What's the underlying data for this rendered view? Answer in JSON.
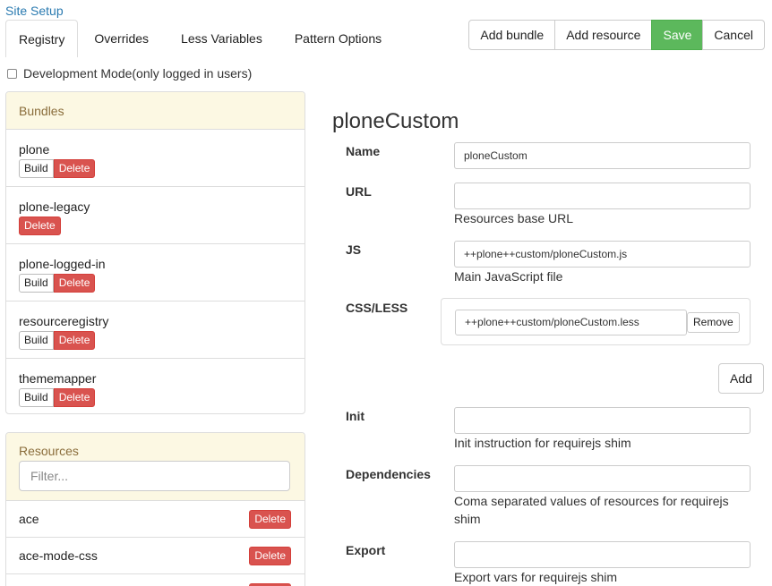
{
  "breadcrumb": "Site Setup",
  "tabs": [
    {
      "label": "Registry",
      "active": true
    },
    {
      "label": "Overrides",
      "active": false
    },
    {
      "label": "Less Variables",
      "active": false
    },
    {
      "label": "Pattern Options",
      "active": false
    }
  ],
  "toolbar": {
    "add_bundle": "Add bundle",
    "add_resource": "Add resource",
    "save": "Save",
    "cancel": "Cancel"
  },
  "dev_mode": {
    "label": "Development Mode(only logged in users)",
    "checked": false
  },
  "bundles": {
    "heading": "Bundles",
    "build_label": "Build",
    "delete_label": "Delete",
    "items": [
      {
        "name": "plone",
        "has_build": true
      },
      {
        "name": "plone-legacy",
        "has_build": false
      },
      {
        "name": "plone-logged-in",
        "has_build": true
      },
      {
        "name": "resourceregistry",
        "has_build": true
      },
      {
        "name": "thememapper",
        "has_build": true
      }
    ]
  },
  "resources": {
    "heading": "Resources",
    "filter_placeholder": "Filter...",
    "delete_label": "Delete",
    "items": [
      {
        "name": "ace"
      },
      {
        "name": "ace-mode-css"
      }
    ]
  },
  "form": {
    "title": "ploneCustom",
    "name": {
      "label": "Name",
      "value": "ploneCustom"
    },
    "url": {
      "label": "URL",
      "value": "",
      "help": "Resources base URL"
    },
    "js": {
      "label": "JS",
      "value": "++plone++custom/ploneCustom.js",
      "help": "Main JavaScript file"
    },
    "css": {
      "label": "CSS/LESS",
      "value": "++plone++custom/ploneCustom.less",
      "remove_label": "Remove",
      "add_label": "Add"
    },
    "init": {
      "label": "Init",
      "value": "",
      "help": "Init instruction for requirejs shim"
    },
    "deps": {
      "label": "Dependencies",
      "value": "",
      "help": "Coma separated values of resources for requirejs shim"
    },
    "export": {
      "label": "Export",
      "value": "",
      "help": "Export vars for requirejs shim"
    }
  },
  "colors": {
    "link": "#2a7ab0",
    "panel_heading_bg": "#fcf8e3",
    "panel_heading_text": "#8a6d3b",
    "danger": "#d9534f",
    "success": "#5cb85c"
  }
}
